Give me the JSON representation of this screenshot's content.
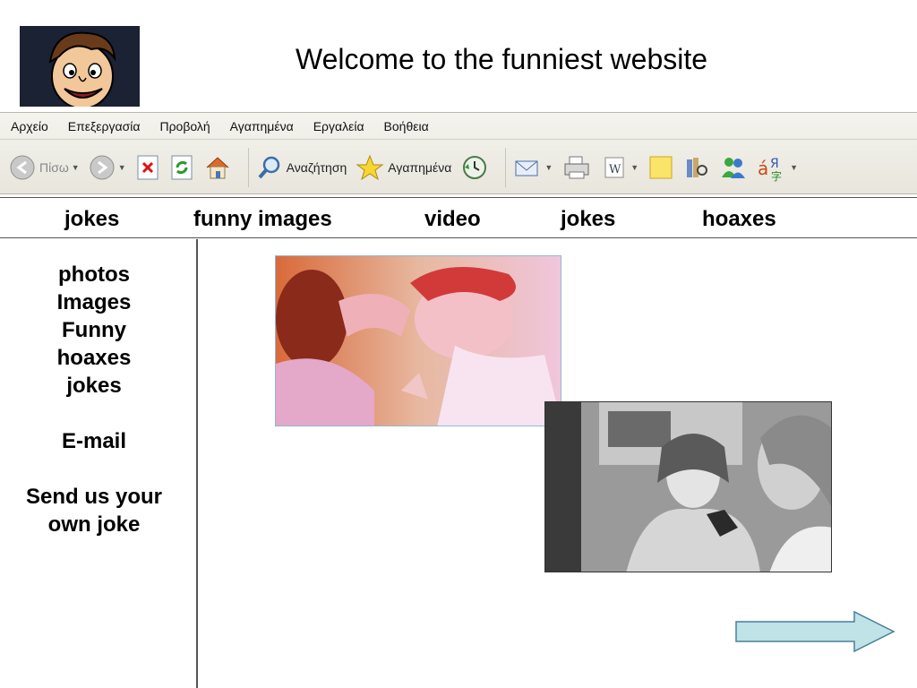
{
  "header": {
    "title": "Welcome to the funniest website"
  },
  "ie": {
    "menu": [
      "Αρχείο",
      "Επεξεργασία",
      "Προβολή",
      "Αγαπημένα",
      "Εργαλεία",
      "Βοήθεια"
    ],
    "back_label": "Πίσω",
    "search_label": "Αναζήτηση",
    "favorites_label": "Αγαπημένα"
  },
  "nav": [
    "jokes",
    "funny images",
    "video",
    "jokes",
    "hoaxes"
  ],
  "sidebar": {
    "items": [
      "photos",
      "Images",
      "Funny",
      "hoaxes",
      "jokes"
    ],
    "email": "E-mail",
    "send_line1": "Send us your",
    "send_line2": "own joke"
  },
  "colors": {
    "arrow_fill": "#bfe3e6",
    "arrow_stroke": "#4a7f9a",
    "photo1_border": "#8fb7e0"
  }
}
